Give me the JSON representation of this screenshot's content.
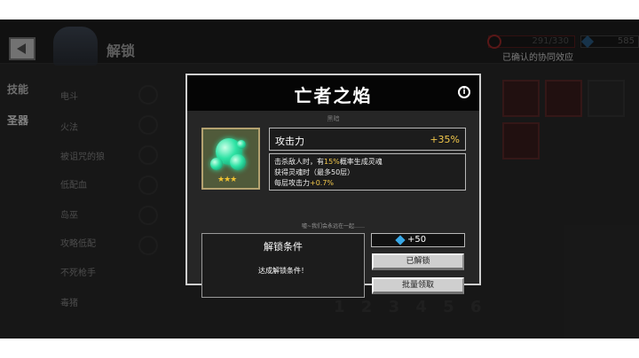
{
  "header": {
    "page_title": "解锁",
    "kill_count": "291/330",
    "gem_count": "585",
    "synergy_label": "已确认的协同效应"
  },
  "nav": {
    "tabs": [
      {
        "label": "技能"
      },
      {
        "label": "圣器"
      }
    ]
  },
  "list": {
    "items": [
      "电斗",
      "火法",
      "被诅咒的狼",
      "低配血",
      "岛巫",
      "攻略低配",
      "不死枪手",
      "毒猪"
    ]
  },
  "pager": {
    "pages": "1 2 3 4 5 6"
  },
  "dialog": {
    "title": "亡者之焰",
    "info_icon": "i",
    "category": "黑暗",
    "stars": "★★★",
    "stat_name": "攻击力",
    "stat_value": "+35%",
    "desc_line1_a": "击杀敌人时，有",
    "desc_line1_hl": "15%",
    "desc_line1_b": "概率生成灵魂",
    "desc_line2": "获得灵魂时（最多50层）",
    "desc_line3_a": "每层攻击力",
    "desc_line3_hl": "+0.7%",
    "flavor": "嘘~我们会永远在一起……",
    "unlock_title": "解锁条件",
    "unlock_desc": "达成解锁条件！",
    "reward": "+50",
    "unlocked_label": "已解锁",
    "claim_label": "批量领取"
  },
  "colors": {
    "highlight": "#f2c84b",
    "dialog_border": "#cfcfcf",
    "relic_glow": "#2ee3a5"
  }
}
